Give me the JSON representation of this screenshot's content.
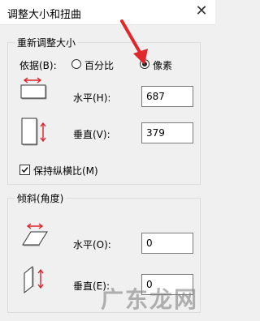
{
  "dialog": {
    "title": "调整大小和扭曲",
    "close_glyph": "✕"
  },
  "resize": {
    "group_title": "重新调整大小",
    "basis_label": "依据(B):",
    "option_percent": "百分比",
    "option_pixels": "像素",
    "selected": "pixels",
    "horizontal_label": "水平(H):",
    "horizontal_value": "687",
    "vertical_label": "垂直(V):",
    "vertical_value": "379",
    "keep_ratio_label": "保持纵横比(M)",
    "keep_ratio_checked": true
  },
  "skew": {
    "group_title": "倾斜(角度)",
    "horizontal_label": "水平(O):",
    "horizontal_value": "0",
    "vertical_label": "垂直(E):",
    "vertical_value": "0"
  },
  "watermark": {
    "text": "广东龙网"
  },
  "colors": {
    "annotation_red": "#e0272b",
    "icon_red": "#d9232a"
  }
}
